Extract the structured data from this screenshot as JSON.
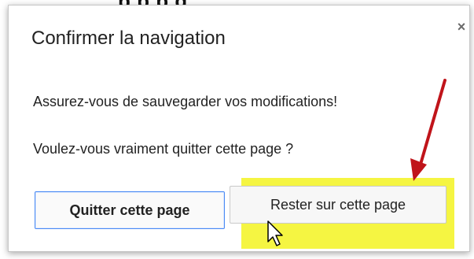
{
  "dialog": {
    "title": "Confirmer la navigation",
    "close_icon": "close-icon",
    "message_save": "Assurez-vous de sauvegarder vos modifications!",
    "message_confirm": "Voulez-vous vraiment quitter cette page ?",
    "leave_button_label": "Quitter cette page",
    "stay_button_label": "Rester sur cette page"
  },
  "colors": {
    "highlight": "#f5f542",
    "arrow": "#c0141a",
    "primary_border": "#4a8af4"
  },
  "icons": {
    "close": "close-icon",
    "arrow": "annotation-arrow-icon",
    "cursor": "mouse-pointer-icon"
  }
}
